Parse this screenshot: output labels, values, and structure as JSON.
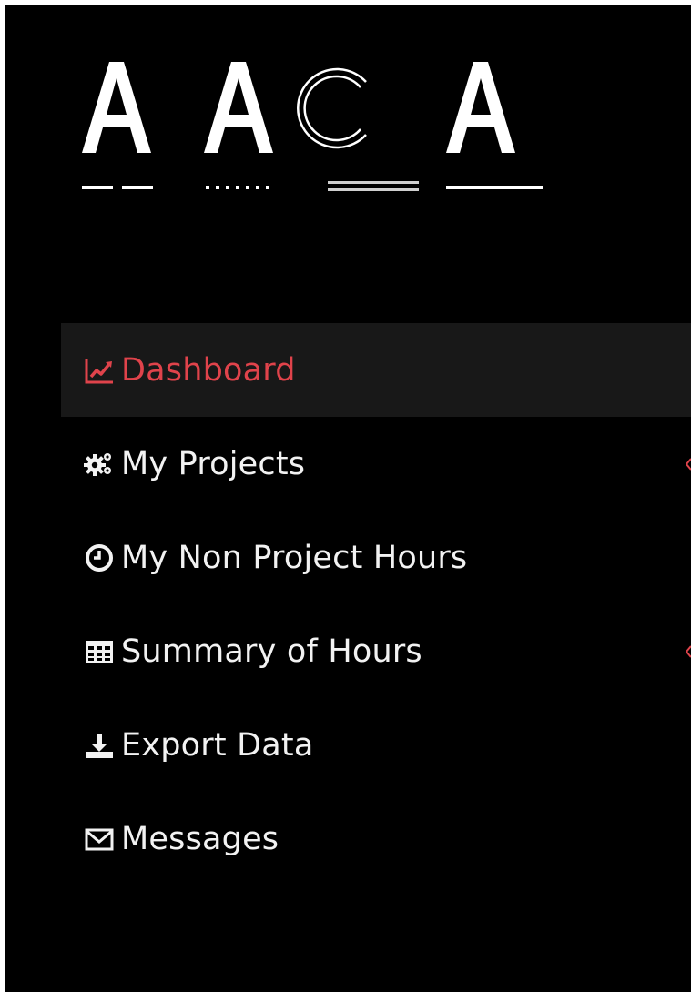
{
  "colors": {
    "sidebar_bg": "#000000",
    "active_bg": "#181818",
    "accent": "#e0434b",
    "text": "#f2f2f2"
  },
  "logo": {
    "text": "AACA"
  },
  "nav": {
    "items": [
      {
        "label": "Dashboard",
        "icon": "line-chart-icon",
        "active": true
      },
      {
        "label": "My Projects",
        "icon": "gears-icon",
        "active": false,
        "has_submenu": true
      },
      {
        "label": "My Non Project Hours",
        "icon": "clock-icon",
        "active": false
      },
      {
        "label": "Summary of Hours",
        "icon": "table-icon",
        "active": false,
        "has_submenu": true
      },
      {
        "label": "Export Data",
        "icon": "download-icon",
        "active": false
      },
      {
        "label": "Messages",
        "icon": "envelope-icon",
        "active": false
      }
    ]
  }
}
